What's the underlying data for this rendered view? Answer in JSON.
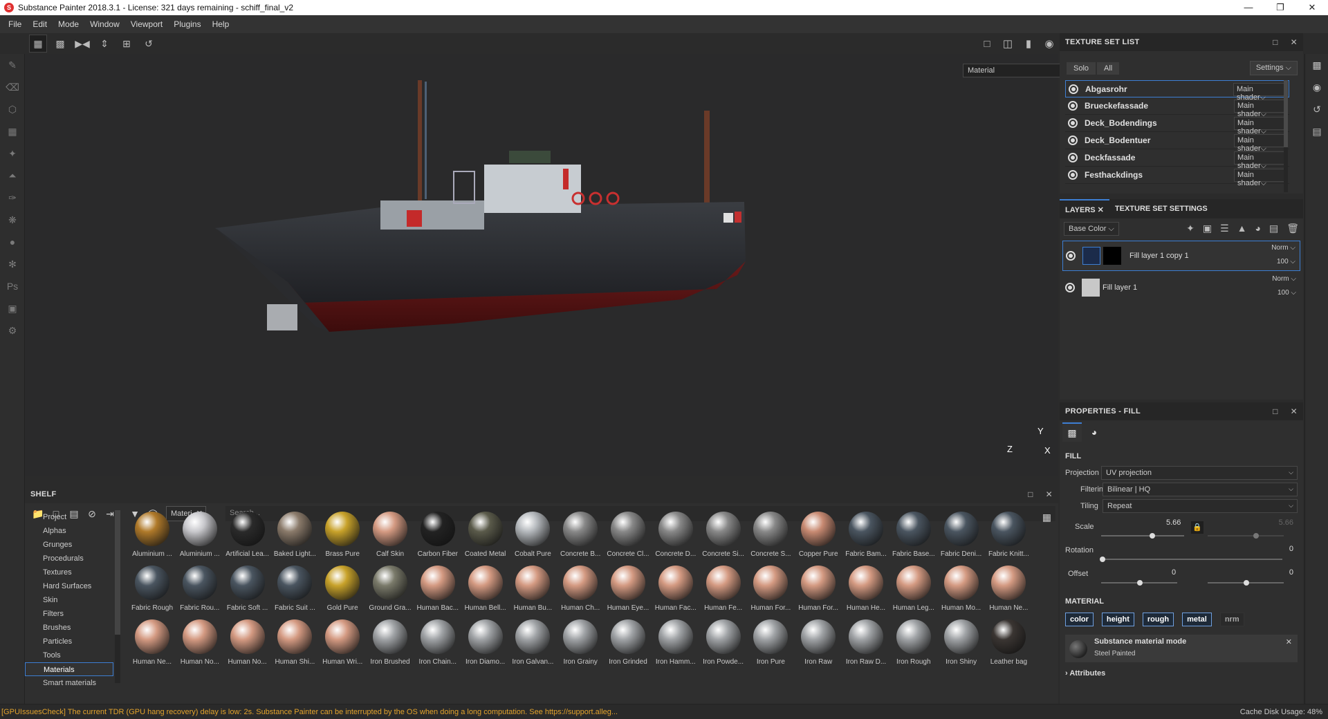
{
  "window": {
    "title": "Substance Painter 2018.3.1 - License: 321 days remaining - schiff_final_v2"
  },
  "menu": [
    "File",
    "Edit",
    "Mode",
    "Window",
    "Viewport",
    "Plugins",
    "Help"
  ],
  "viewport": {
    "mode_select": "Material",
    "axis_labels": [
      "Y",
      "Z",
      "X"
    ]
  },
  "texture_set_list": {
    "title": "TEXTURE SET LIST",
    "filters": [
      "Solo",
      "All"
    ],
    "settings_label": "Settings",
    "items": [
      {
        "name": "Abgasrohr",
        "shader": "Main shader",
        "selected": true
      },
      {
        "name": "Brueckefassade",
        "shader": "Main shader"
      },
      {
        "name": "Deck_Bodendings",
        "shader": "Main shader"
      },
      {
        "name": "Deck_Bodentuer",
        "shader": "Main shader"
      },
      {
        "name": "Deckfassade",
        "shader": "Main shader"
      },
      {
        "name": "Festhackdings",
        "shader": "Main shader"
      }
    ]
  },
  "layers": {
    "tabs": [
      "LAYERS",
      "TEXTURE SET SETTINGS"
    ],
    "channel": "Base Color",
    "items": [
      {
        "name": "Fill layer 1 copy 1",
        "blend": "Norm",
        "opacity": "100",
        "selected": true
      },
      {
        "name": "Fill layer 1",
        "blend": "Norm",
        "opacity": "100"
      }
    ]
  },
  "properties": {
    "title": "PROPERTIES - FILL",
    "fill_section": "FILL",
    "projection": {
      "label": "Projection",
      "value": "UV projection"
    },
    "filtering": {
      "label": "Filtering",
      "value": "Bilinear | HQ"
    },
    "tiling": {
      "label": "Tiling",
      "value": "Repeat"
    },
    "scale": {
      "label": "Scale",
      "value": "5.66",
      "value2": "5.66"
    },
    "rotation": {
      "label": "Rotation",
      "value": "0"
    },
    "offset": {
      "label": "Offset",
      "value": "0",
      "value2": "0"
    },
    "material_section": "MATERIAL",
    "channels": [
      {
        "label": "color",
        "on": true
      },
      {
        "label": "height",
        "on": true
      },
      {
        "label": "rough",
        "on": true
      },
      {
        "label": "metal",
        "on": true
      },
      {
        "label": "nrm",
        "on": false
      }
    ],
    "mode_title": "Substance material mode",
    "mode_value": "Steel Painted",
    "attributes": "Attributes"
  },
  "shelf": {
    "title": "SHELF",
    "filter_chip": "Materi..",
    "search_placeholder": "Search...",
    "categories": [
      "Project",
      "Alphas",
      "Grunges",
      "Procedurals",
      "Textures",
      "Hard Surfaces",
      "Skin",
      "Filters",
      "Brushes",
      "Particles",
      "Tools",
      "Materials",
      "Smart materials"
    ],
    "selected_category": "Materials",
    "materials": [
      [
        "Aluminium ...",
        "Aluminium ...",
        "Artificial Lea...",
        "Baked Light...",
        "Brass Pure",
        "Calf Skin",
        "Carbon Fiber",
        "Coated Metal",
        "Cobalt Pure",
        "Concrete B...",
        "Concrete Cl...",
        "Concrete D...",
        "Concrete Si...",
        "Concrete S...",
        "Copper Pure",
        "Fabric Bam...",
        "Fabric Base...",
        "Fabric Deni...",
        "Fabric Knitt..."
      ],
      [
        "Fabric Rough",
        "Fabric Rou...",
        "Fabric Soft ...",
        "Fabric Suit ...",
        "Gold Pure",
        "Ground Gra...",
        "Human Bac...",
        "Human Bell...",
        "Human Bu...",
        "Human Ch...",
        "Human Eye...",
        "Human Fac...",
        "Human Fe...",
        "Human For...",
        "Human For...",
        "Human He...",
        "Human Leg...",
        "Human Mo...",
        "Human Ne..."
      ],
      [
        "Human Ne...",
        "Human No...",
        "Human No...",
        "Human Shi...",
        "Human Wri...",
        "Iron Brushed",
        "Iron Chain...",
        "Iron Diamo...",
        "Iron Galvan...",
        "Iron Grainy",
        "Iron Grinded",
        "Iron Hamm...",
        "Iron Powde...",
        "Iron Pure",
        "Iron Raw",
        "Iron Raw D...",
        "Iron Rough",
        "Iron Shiny",
        "Leather bag"
      ]
    ]
  },
  "status": {
    "message": "[GPUIssuesCheck] The current TDR (GPU hang recovery) delay is low: 2s. Substance Painter can be interrupted by the OS when doing a long computation. See https://support.alleg...",
    "cache": "Cache Disk Usage:   48%"
  }
}
